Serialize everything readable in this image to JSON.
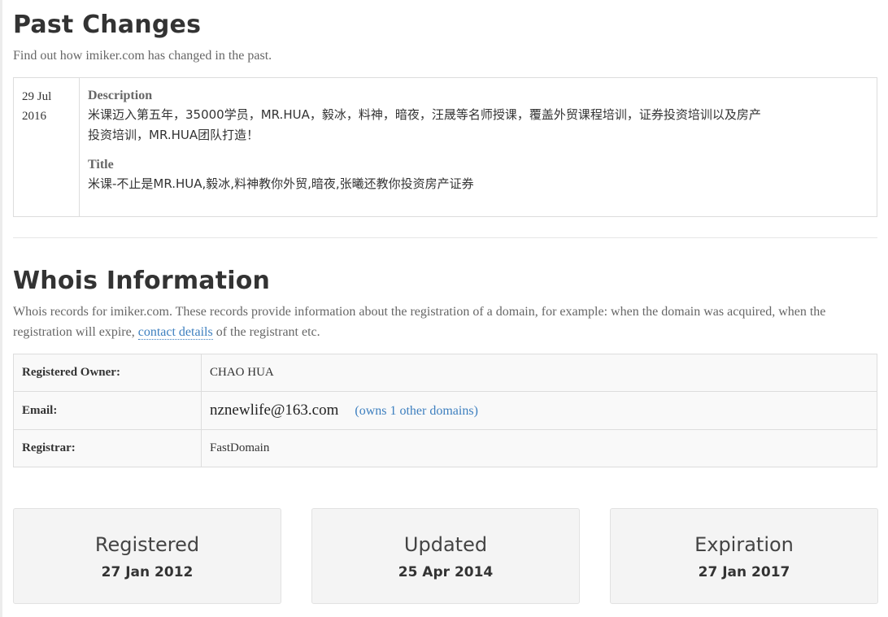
{
  "past_changes": {
    "heading": "Past Changes",
    "subtitle": "Find out how imiker.com has changed in the past.",
    "entries": [
      {
        "date_day_month": "29 Jul",
        "date_year": "2016",
        "description_label": "Description",
        "description_line1": "米课迈入第五年，35000学员，MR.HUA，毅冰，料神，暗夜，汪晟等名师授课，覆盖外贸课程培训，证券投资培训以及房产",
        "description_line2": "投资培训，MR.HUA团队打造！",
        "title_label": "Title",
        "title_value": "米课-不止是MR.HUA,毅冰,料神教你外贸,暗夜,张曦还教你投资房产证券"
      }
    ]
  },
  "whois": {
    "heading": "Whois Information",
    "intro_before_link": "Whois records for imiker.com. These records provide information about the registration of a domain, for example: when the domain was acquired, when the registration will expire, ",
    "intro_link": "contact details",
    "intro_after_link": " of the registrant etc.",
    "rows": [
      {
        "label": "Registered Owner:",
        "value": "CHAO HUA"
      },
      {
        "label": "Email:",
        "value": "nznewlife@163.com",
        "link": "(owns 1 other domains)"
      },
      {
        "label": "Registrar:",
        "value": "FastDomain"
      }
    ]
  },
  "dates": [
    {
      "title": "Registered",
      "date": "27 Jan 2012"
    },
    {
      "title": "Updated",
      "date": "25 Apr 2014"
    },
    {
      "title": "Expiration",
      "date": "27 Jan 2017"
    }
  ],
  "colors": {
    "link": "#3d7fbf",
    "border": "#dddddd",
    "card_bg": "#f4f4f4"
  }
}
